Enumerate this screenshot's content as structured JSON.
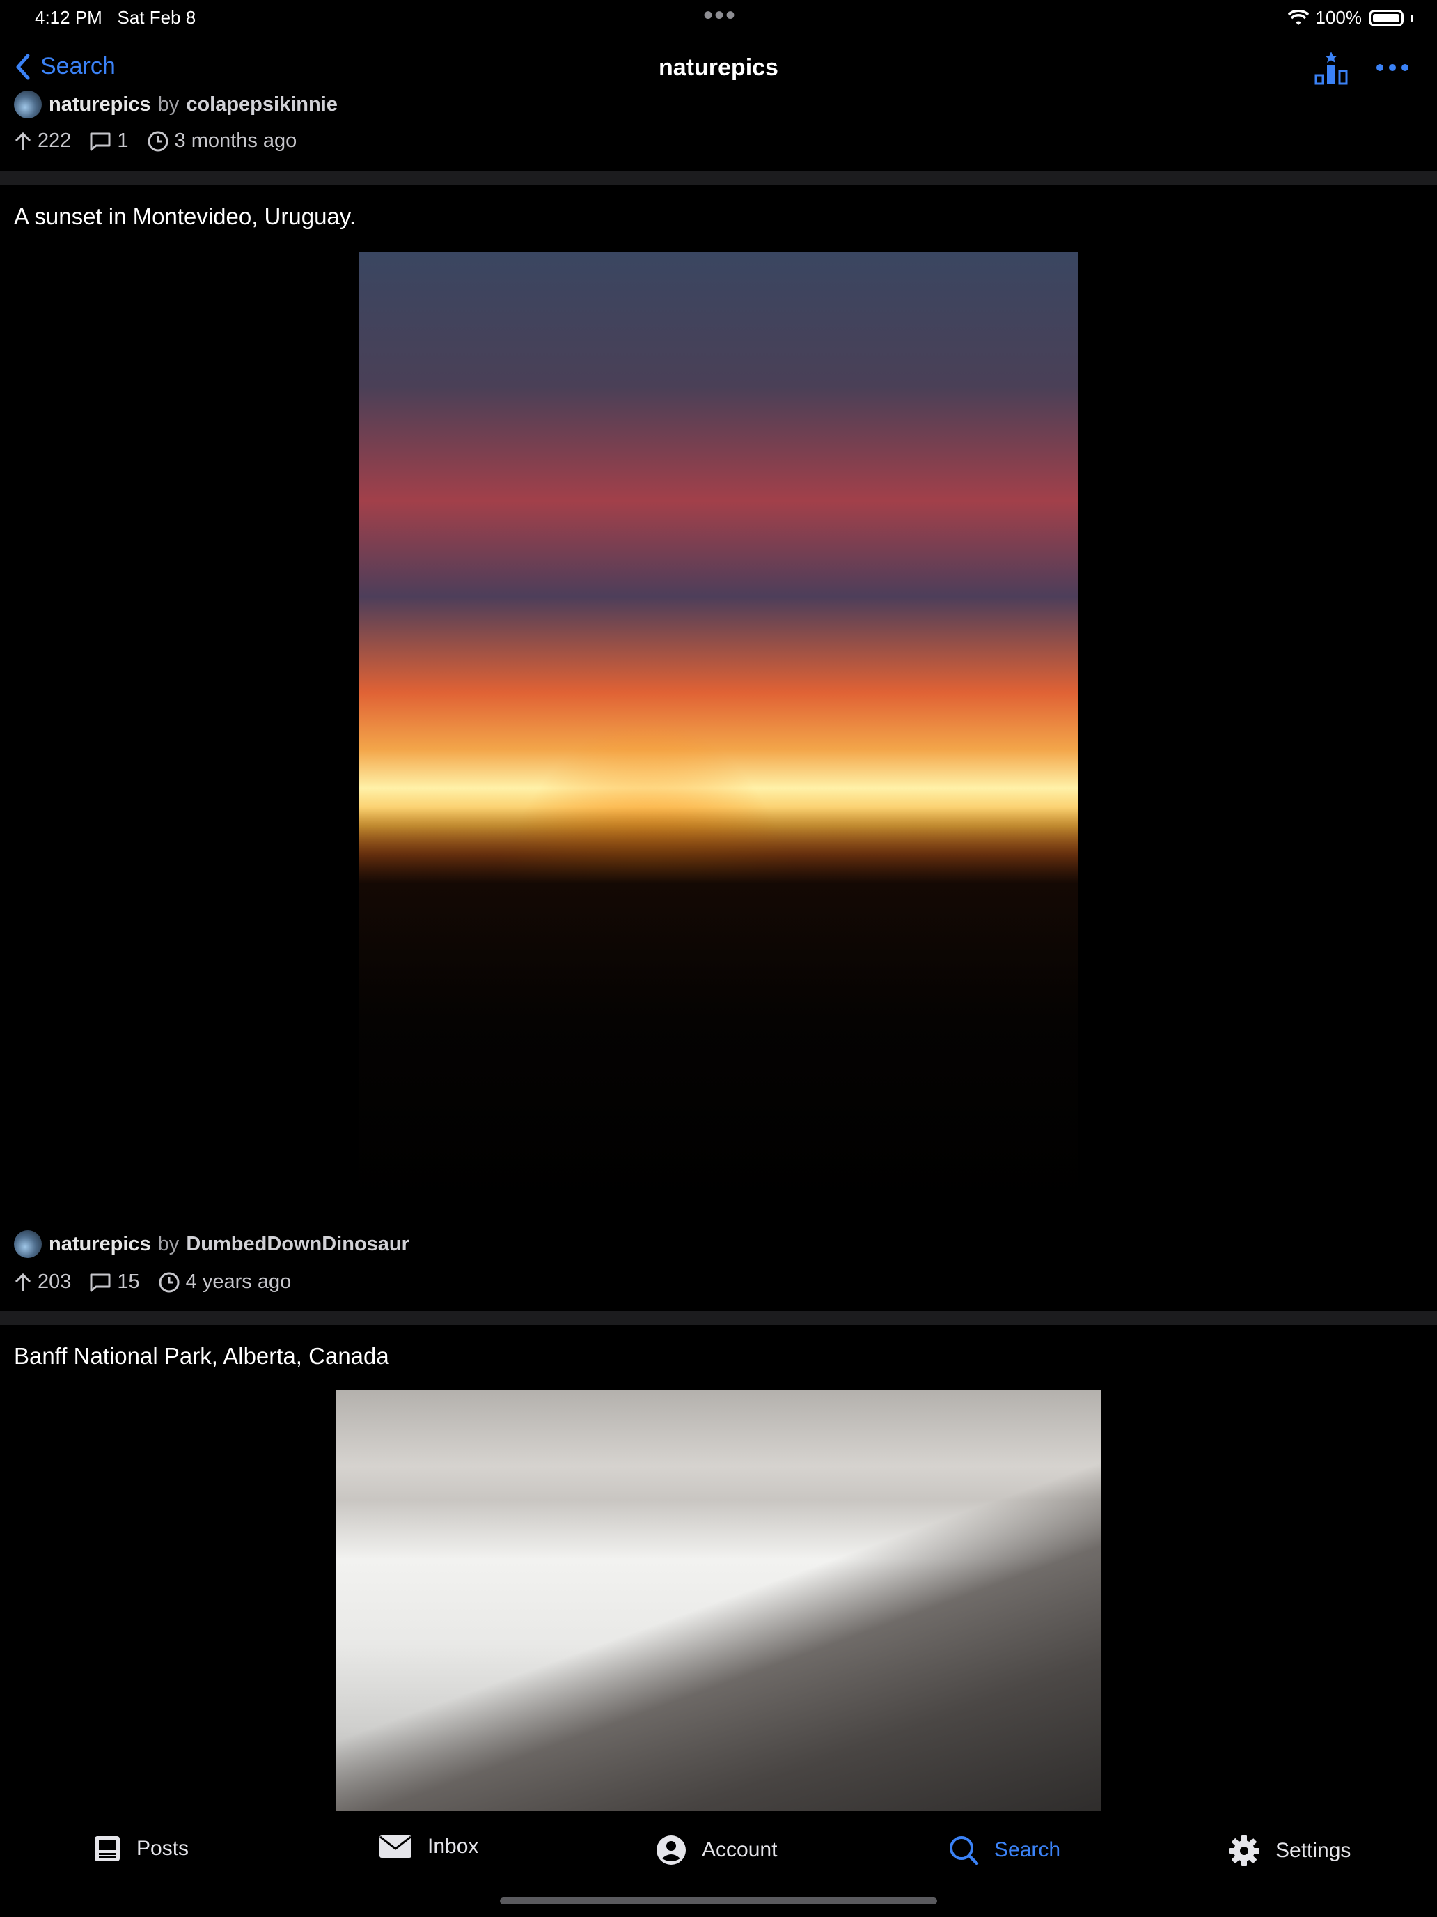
{
  "status_bar": {
    "time": "4:12 PM",
    "date": "Sat Feb 8",
    "battery": "100%"
  },
  "nav": {
    "back_label": "Search",
    "title": "naturepics"
  },
  "posts": [
    {
      "community": "naturepics",
      "by": "by",
      "author": "colapepsikinnie",
      "upvotes": "222",
      "comments": "1",
      "age": "3 months ago"
    },
    {
      "title": "A sunset in Montevideo, Uruguay.",
      "community": "naturepics",
      "by": "by",
      "author": "DumbedDownDinosaur",
      "upvotes": "203",
      "comments": "15",
      "age": "4 years ago"
    },
    {
      "title": "Banff National Park, Alberta, Canada"
    }
  ],
  "tabs": [
    {
      "label": "Posts",
      "icon": "posts-icon",
      "active": false
    },
    {
      "label": "Inbox",
      "icon": "envelope-icon",
      "active": false
    },
    {
      "label": "Account",
      "icon": "person-circle-icon",
      "active": false
    },
    {
      "label": "Search",
      "icon": "search-icon",
      "active": true
    },
    {
      "label": "Settings",
      "icon": "gear-icon",
      "active": false
    }
  ],
  "colors": {
    "accent": "#3b82f6",
    "background": "#000000",
    "divider": "#1c1c1e"
  }
}
